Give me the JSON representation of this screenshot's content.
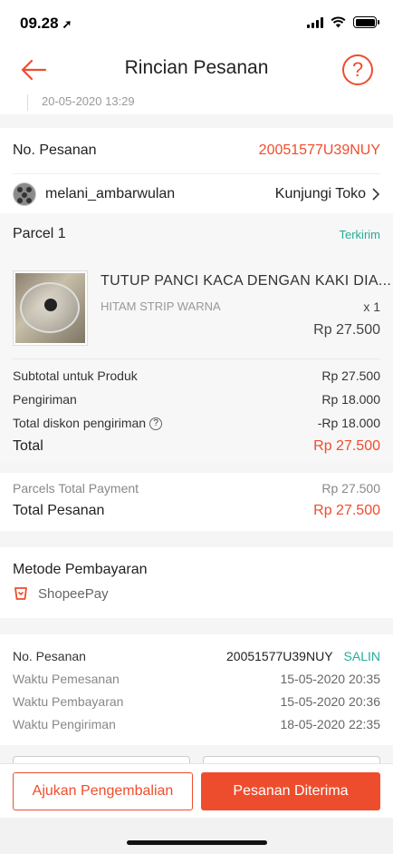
{
  "status_bar": {
    "time": "09.28",
    "location_icon": "location-arrow-icon"
  },
  "header": {
    "title": "Rincian Pesanan",
    "help_symbol": "?"
  },
  "timeline": {
    "timestamp": "20-05-2020 13:29"
  },
  "order": {
    "label": "No. Pesanan",
    "number": "20051577U39NUY",
    "shop_name": "melani_ambarwulan",
    "visit_label": "Kunjungi Toko"
  },
  "parcel": {
    "title": "Parcel 1",
    "status": "Terkirim",
    "product": {
      "name": "TUTUP PANCI KACA DENGAN KAKI DIA...",
      "variant": "HITAM STRIP WARNA",
      "qty": "x 1",
      "price": "Rp 27.500"
    },
    "summary": [
      {
        "label": "Subtotal untuk Produk",
        "value": "Rp 27.500"
      },
      {
        "label": "Pengiriman",
        "value": "Rp 18.000"
      },
      {
        "label": "Total diskon pengiriman",
        "value": "-Rp 18.000"
      }
    ],
    "total_label": "Total",
    "total_value": "Rp 27.500"
  },
  "totals": {
    "parcels_label": "Parcels Total Payment",
    "parcels_value": "Rp 27.500",
    "order_total_label": "Total Pesanan",
    "order_total_value": "Rp 27.500"
  },
  "payment": {
    "title": "Metode Pembayaran",
    "method": "ShopeePay"
  },
  "info": {
    "order_label": "No. Pesanan",
    "order_value": "20051577U39NUY",
    "copy_label": "SALIN",
    "rows": [
      {
        "label": "Waktu Pemesanan",
        "value": "15-05-2020 20:35"
      },
      {
        "label": "Waktu Pembayaran",
        "value": "15-05-2020 20:36"
      },
      {
        "label": "Waktu Pengiriman",
        "value": "18-05-2020 22:35"
      }
    ]
  },
  "actions": {
    "return_label": "Ajukan Pengembalian",
    "received_label": "Pesanan Diterima"
  },
  "colors": {
    "accent": "#ee4d2d",
    "success": "#26aa99"
  }
}
